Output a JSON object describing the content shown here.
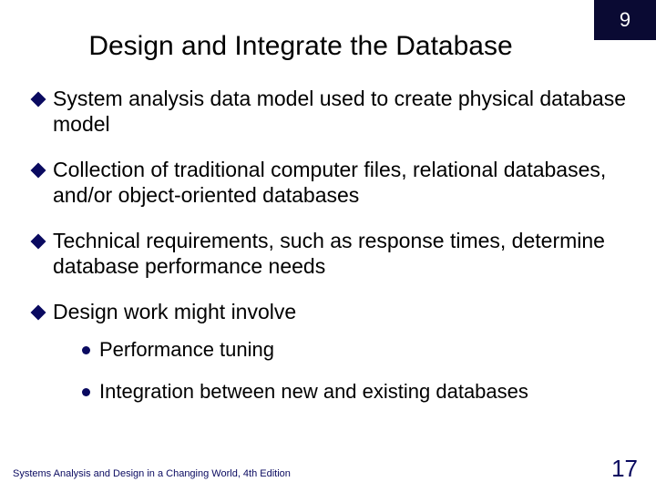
{
  "chapter": "9",
  "title": "Design and Integrate the Database",
  "bullets": [
    "System analysis data model used to create physical database model",
    "Collection of traditional computer files, relational databases, and/or object-oriented databases",
    "Technical requirements, such as response times, determine database performance needs",
    "Design work might involve"
  ],
  "subbullets": [
    "Performance tuning",
    "Integration between new and existing databases"
  ],
  "footer": "Systems Analysis and Design in a Changing World, 4th Edition",
  "page_number": "17"
}
